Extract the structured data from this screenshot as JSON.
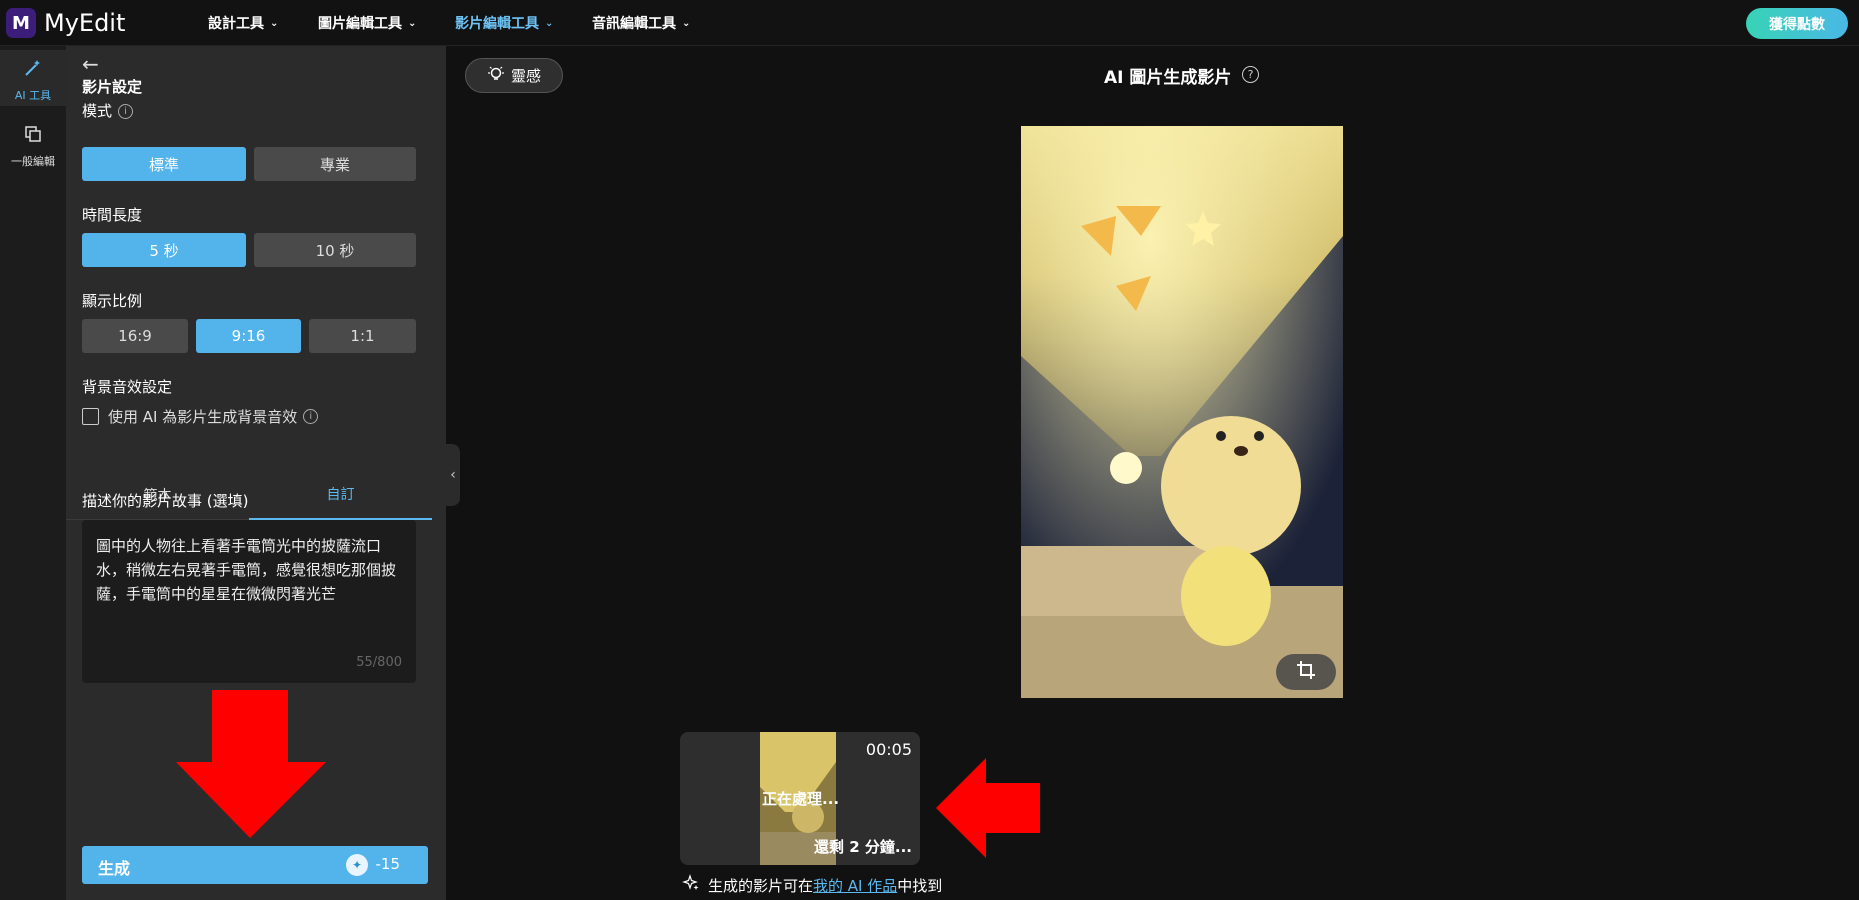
{
  "header": {
    "logo_mark": "M",
    "logo_text": "MyEdit",
    "nav": [
      {
        "label": "設計工具"
      },
      {
        "label": "圖片編輯工具"
      },
      {
        "label": "影片編輯工具"
      },
      {
        "label": "音訊編輯工具"
      }
    ],
    "points_button": "獲得點數"
  },
  "rail": {
    "ai_tools": "AI 工具",
    "general_edit": "一般編輯"
  },
  "panel": {
    "title": "影片設定",
    "mode_label": "模式",
    "mode_standard": "標準",
    "mode_pro": "專業",
    "duration_label": "時間長度",
    "duration_5": "5 秒",
    "duration_10": "10 秒",
    "ratio_label": "顯示比例",
    "ratio_169": "16:9",
    "ratio_916": "9:16",
    "ratio_11": "1:1",
    "bgm_label": "背景音效設定",
    "bgm_checkbox": "使用 AI 為影片生成背景音效",
    "tab_template": "範本",
    "tab_custom": "自訂",
    "story_label": "描述你的影片故事 (選填)",
    "story_text": "圖中的人物往上看著手電筒光中的披薩流口水，稍微左右晃著手電筒，感覺很想吃那個披薩，手電筒中的星星在微微閃著光芒",
    "char_count": "55/800",
    "generate_label": "生成",
    "generate_cost": "-15"
  },
  "main": {
    "inspire_button": "靈感",
    "title": "AI 圖片生成影片",
    "job": {
      "duration": "00:05",
      "status": "正在處理...",
      "remaining": "還剩 2 分鐘..."
    },
    "hint_prefix": "生成的影片可在",
    "hint_link": "我的 AI 作品",
    "hint_suffix": "中找到"
  },
  "colors": {
    "accent": "#53b4ec",
    "annotation_arrow": "#ff0000"
  }
}
